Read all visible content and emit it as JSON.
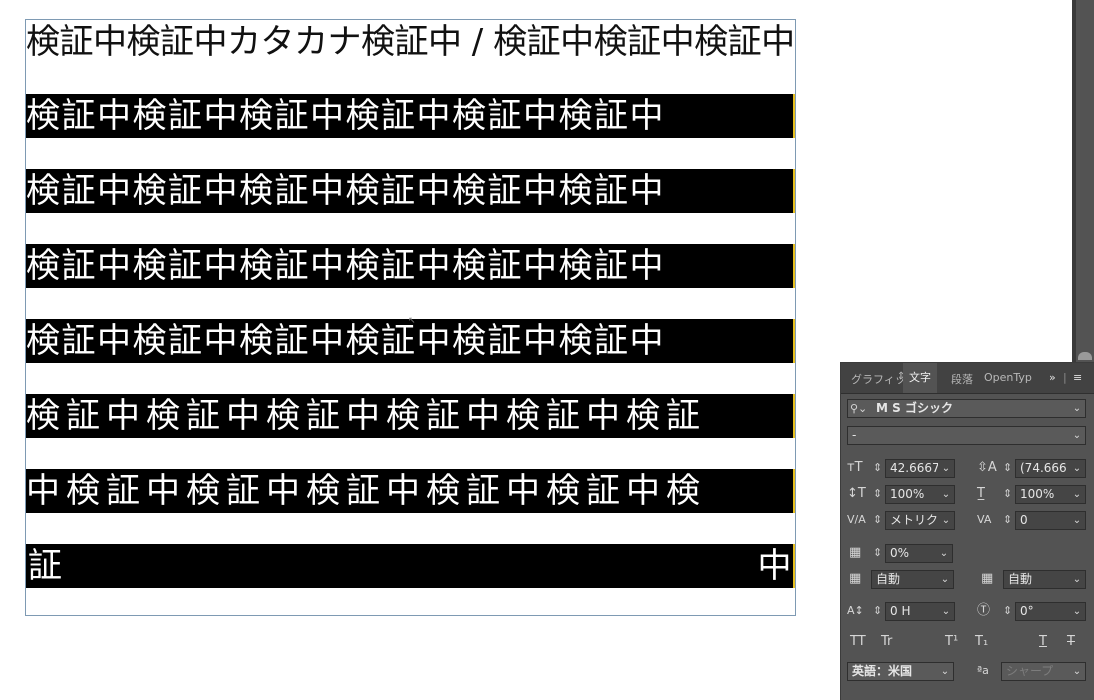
{
  "document": {
    "line1": "検証中検証中カタカナ検証中 / 検証中検証中検証中",
    "line2": "検証中検証中検証中検証中検証中検証中",
    "line3": "検証中検証中検証中検証中検証中検証中",
    "line4": "検証中検証中検証中検証中検証中検証中",
    "line5": "検証中検証中検証中検証中検証中検証中",
    "line6": "検証中検証中検証中検証中検証中検証",
    "line7": "中検証中検証中検証中検証中検証中検",
    "line8_left": "証",
    "line8_right": "中"
  },
  "panel": {
    "tabs": {
      "glyphs": "グラフィッ:",
      "character": "文字",
      "paragraph": "段落",
      "opentype": "OpenTyp",
      "more": "»",
      "menu": "≡"
    },
    "font_family": "M S ゴシック",
    "font_style": "-",
    "font_size": "42.6667",
    "leading": "(74.666",
    "vertical_scale": "100%",
    "horizontal_scale": "100%",
    "kerning": "メトリク",
    "tracking": "0",
    "tsume": "0%",
    "aki_left": "自動",
    "aki_right": "自動",
    "baseline_shift": "0 H",
    "rotation": "0°",
    "language": "英語：米国",
    "antialias": "シャープ",
    "style_buttons": {
      "all_caps": "TT",
      "small_caps": "Tr",
      "superscript": "T¹",
      "subscript": "T₁",
      "underline": "T",
      "strikethrough": "T"
    },
    "antialias_icon_label": "ªa"
  }
}
